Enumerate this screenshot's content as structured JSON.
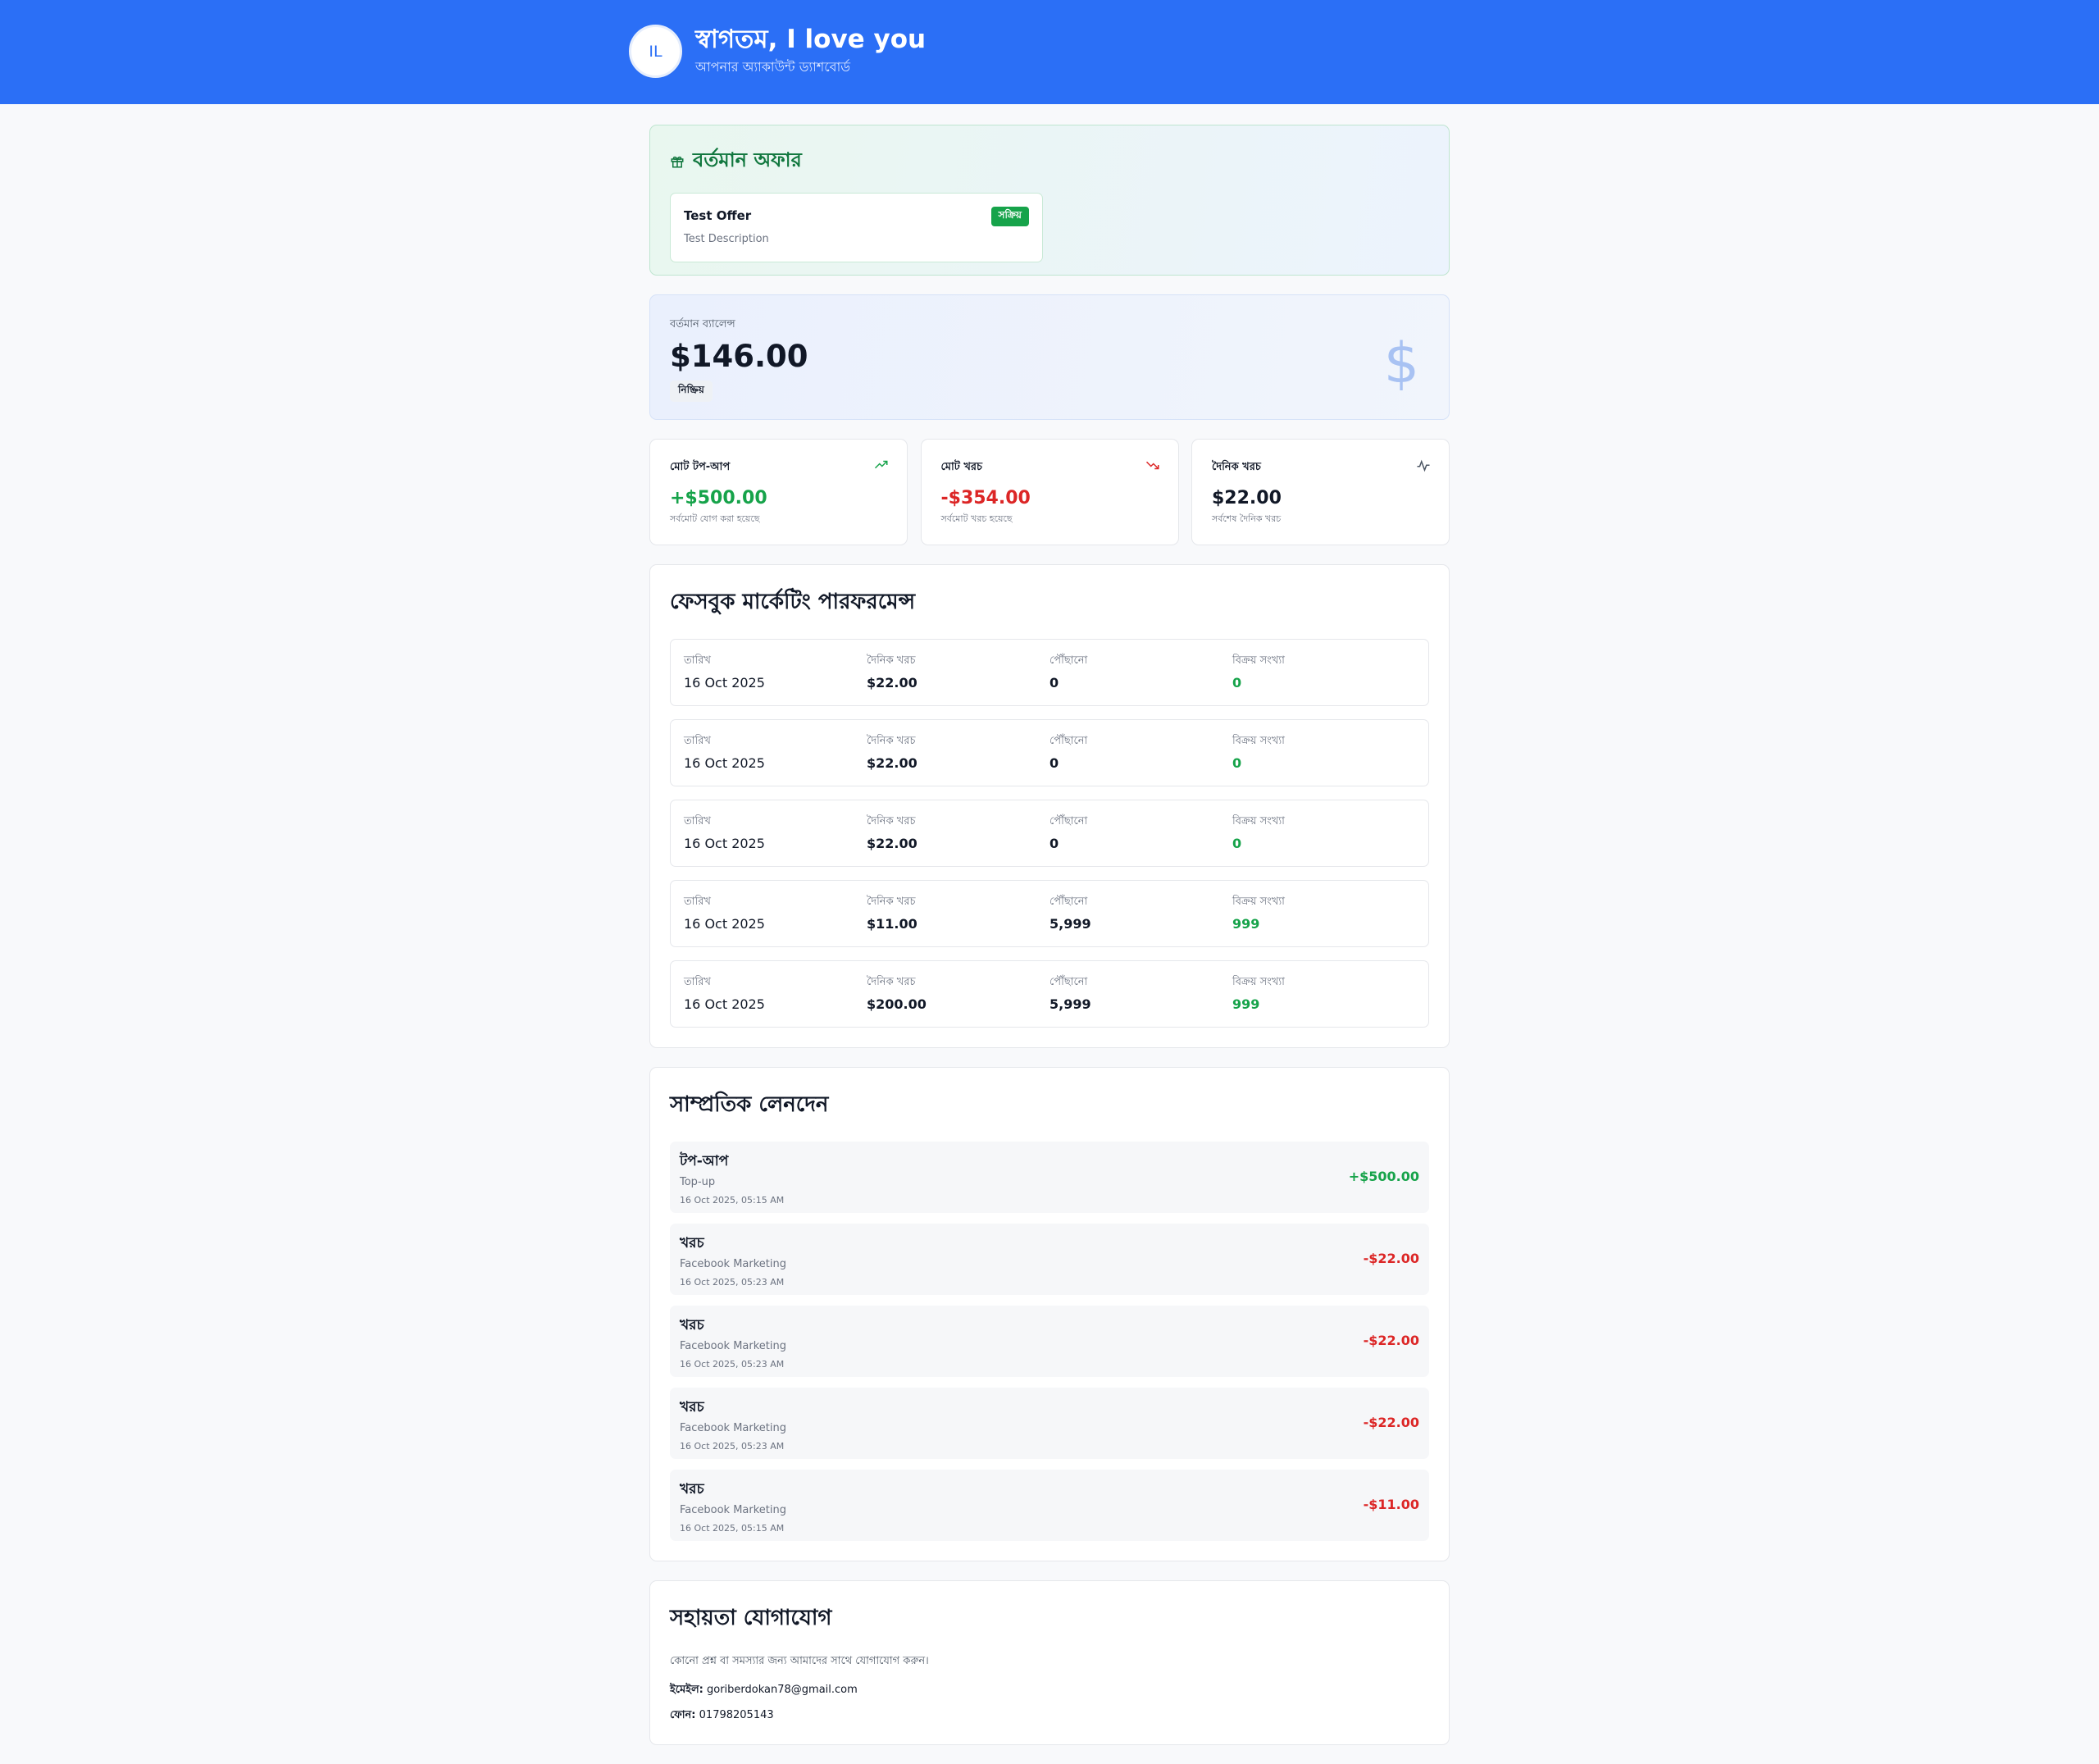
{
  "header": {
    "avatar_initials": "IL",
    "title": "স্বাগতম, I love you",
    "subtitle": "আপনার অ্যাকাউন্ট ড্যাশবোর্ড"
  },
  "offers": {
    "title": "বর্তমান অফার",
    "items": [
      {
        "name": "Test Offer",
        "description": "Test Description",
        "status": "সক্রিয়"
      }
    ]
  },
  "balance": {
    "label": "বর্তমান ব্যালেন্স",
    "amount": "$146.00",
    "status": "নিষ্ক্রিয়"
  },
  "stats": [
    {
      "label": "মোট টপ-আপ",
      "value": "+$500.00",
      "note": "সর্বমোট যোগ করা হয়েছে",
      "icon": "trending-up-icon"
    },
    {
      "label": "মোট খরচ",
      "value": "-$354.00",
      "note": "সর্বমোট খরচ হয়েছে",
      "icon": "trending-down-icon"
    },
    {
      "label": "দৈনিক খরচ",
      "value": "$22.00",
      "note": "সর্বশেষ দৈনিক খরচ",
      "icon": "activity-icon"
    }
  ],
  "performance": {
    "title": "ফেসবুক মার্কেটিং পারফরমেন্স",
    "labels": {
      "date": "তারিখ",
      "daily_cost": "দৈনিক খরচ",
      "reach": "পৌঁছানো",
      "sales": "বিক্রয় সংখ্যা"
    },
    "rows": [
      {
        "date": "16 Oct 2025",
        "daily_cost": "$22.00",
        "reach": "0",
        "sales": "0"
      },
      {
        "date": "16 Oct 2025",
        "daily_cost": "$22.00",
        "reach": "0",
        "sales": "0"
      },
      {
        "date": "16 Oct 2025",
        "daily_cost": "$22.00",
        "reach": "0",
        "sales": "0"
      },
      {
        "date": "16 Oct 2025",
        "daily_cost": "$11.00",
        "reach": "5,999",
        "sales": "999"
      },
      {
        "date": "16 Oct 2025",
        "daily_cost": "$200.00",
        "reach": "5,999",
        "sales": "999"
      }
    ]
  },
  "transactions": {
    "title": "সাম্প্রতিক লেনদেন",
    "rows": [
      {
        "type": "টপ-আপ",
        "description": "Top-up",
        "time": "16 Oct 2025, 05:15 AM",
        "amount": "+$500.00"
      },
      {
        "type": "খরচ",
        "description": "Facebook Marketing",
        "time": "16 Oct 2025, 05:23 AM",
        "amount": "-$22.00"
      },
      {
        "type": "খরচ",
        "description": "Facebook Marketing",
        "time": "16 Oct 2025, 05:23 AM",
        "amount": "-$22.00"
      },
      {
        "type": "খরচ",
        "description": "Facebook Marketing",
        "time": "16 Oct 2025, 05:23 AM",
        "amount": "-$22.00"
      },
      {
        "type": "খরচ",
        "description": "Facebook Marketing",
        "time": "16 Oct 2025, 05:15 AM",
        "amount": "-$11.00"
      }
    ]
  },
  "support": {
    "title": "সহায়তা যোগাযোগ",
    "description": "কোনো প্রশ্ন বা সমস্যার জন্য আমাদের সাথে যোগাযোগ করুন।",
    "email_label": "ইমেইল:",
    "email": "goriberdokan78@gmail.com",
    "phone_label": "ফোন:",
    "phone": "01798205143"
  },
  "colors": {
    "header_bg": "#2b6ff6",
    "positive": "#16a34a",
    "negative": "#dc2626"
  }
}
